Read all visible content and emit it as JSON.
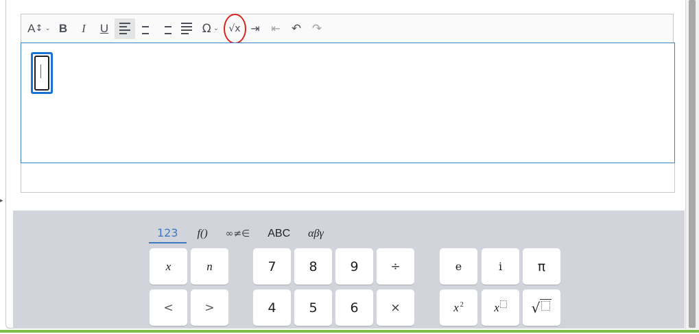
{
  "toolbar": {
    "font_size_label": "A",
    "bold_label": "B",
    "italic_label": "I",
    "underline_label": "U",
    "omega_label": "Ω",
    "sqrt_label": "√x",
    "undo_label": "↶",
    "redo_label": "↷"
  },
  "keyboard": {
    "tabs": [
      "123",
      "f()",
      "∞≠∈",
      "ABC",
      "αβγ"
    ],
    "active_tab": "123",
    "keys": {
      "x": "x",
      "n": "n",
      "seven": "7",
      "eight": "8",
      "nine": "9",
      "divide": "÷",
      "e": "e",
      "i": "i",
      "pi": "π",
      "lt": "<",
      "gt": ">",
      "four": "4",
      "five": "5",
      "six": "6",
      "times": "×",
      "x_squared_base": "x",
      "x_squared_exp": "2",
      "x_power_base": "x"
    }
  },
  "colors": {
    "accent": "#3d76c2",
    "highlight_circle": "#d9251c",
    "editor_border": "#3e82c4",
    "keyboard_bg": "#d1d5db",
    "bottom_line": "#7cc04a"
  }
}
